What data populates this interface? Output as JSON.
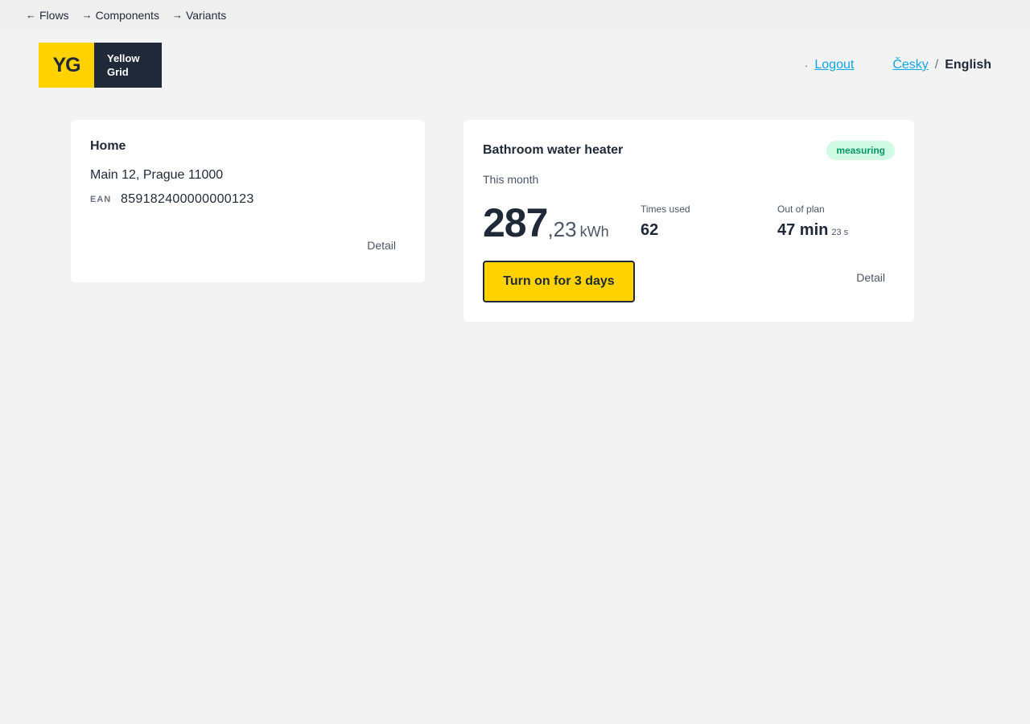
{
  "devnav": {
    "flows": "Flows",
    "components": "Components",
    "variants": "Variants",
    "back_arrow": "←",
    "forward_arrow": "→"
  },
  "header": {
    "logo_mark": "YG",
    "logo_line1": "Yellow",
    "logo_line2": "Grid",
    "dot": "·",
    "logout": "Logout",
    "lang_cs": "Česky",
    "lang_sep": "/",
    "lang_en": "English"
  },
  "home_card": {
    "title": "Home",
    "address": "Main 12, Prague 11000",
    "ean_label": "EAN",
    "ean_value": "859182400000000123",
    "detail": "Detail"
  },
  "heater_card": {
    "title": "Bathroom water heater",
    "badge": "measuring",
    "period": "This month",
    "energy_int": "287",
    "energy_dec": ",23",
    "energy_unit": "kWh",
    "times_used_label": "Times used",
    "times_used_value": "62",
    "out_of_plan_label": "Out of plan",
    "out_of_plan_value": "47 min",
    "out_of_plan_sub": "23 s",
    "turn_on": "Turn on for 3 days",
    "detail": "Detail"
  },
  "colors": {
    "brand_yellow": "#ffd200",
    "brand_dark": "#1f2937",
    "link": "#0ea5e9",
    "badge_bg": "#d1fae5",
    "badge_text": "#059669"
  }
}
